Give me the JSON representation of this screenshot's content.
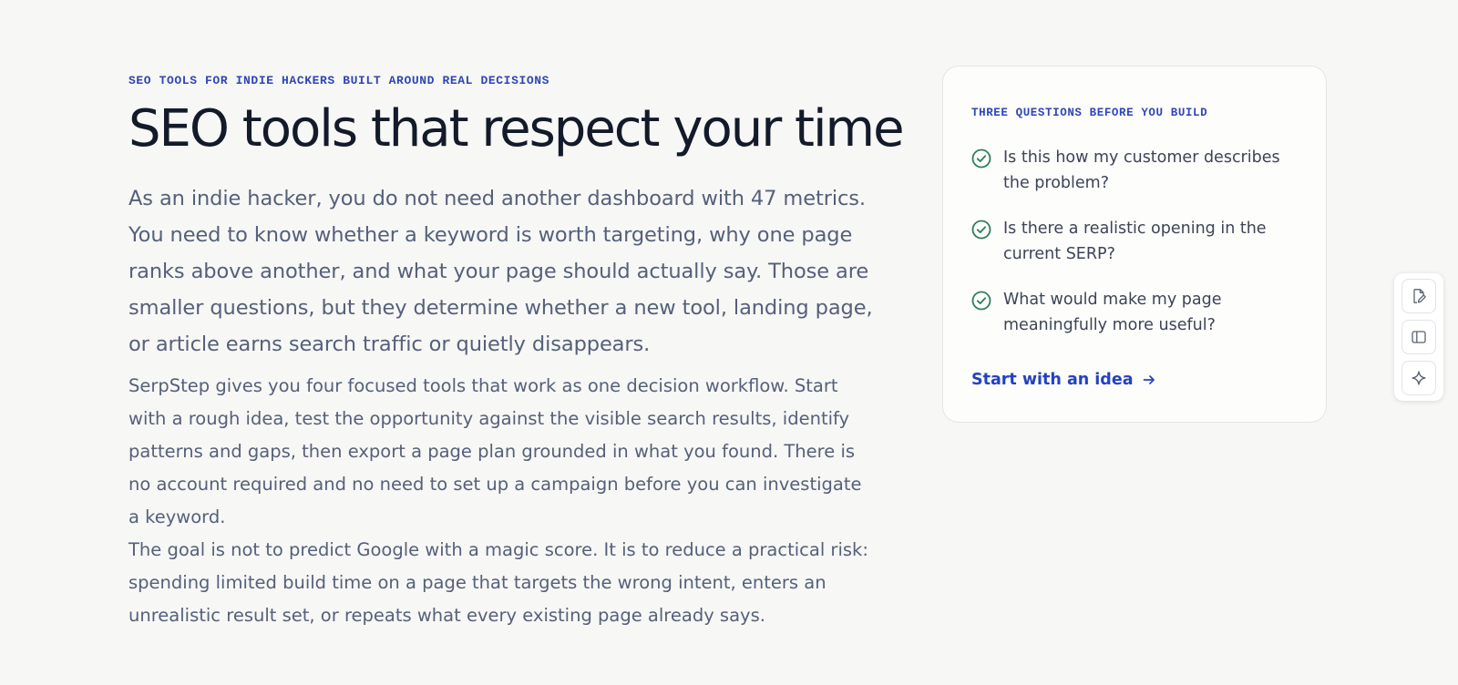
{
  "hero": {
    "eyebrow": "SEO TOOLS FOR INDIE HACKERS BUILT AROUND REAL DECISIONS",
    "title": "SEO tools that respect your time",
    "lead": "As an indie hacker, you do not need another dashboard with 47 metrics. You need to know whether a keyword is worth targeting, why one page ranks above another, and what your page should actually say. Those are smaller questions, but they determine whether a new tool, landing page, or article earns search traffic or quietly disappears.",
    "paragraphs": [
      "SerpStep gives you four focused tools that work as one decision workflow. Start with a rough idea, test the opportunity against the visible search results, identify patterns and gaps, then export a page plan grounded in what you found. There is no account required and no need to set up a campaign before you can investigate a keyword.",
      "The goal is not to predict Google with a magic score. It is to reduce a practical risk: spending limited build time on a page that targets the wrong intent, enters an unrealistic result set, or repeats what every existing page already says."
    ]
  },
  "card": {
    "eyebrow": "THREE QUESTIONS BEFORE YOU BUILD",
    "questions": [
      "Is this how my customer describes the problem?",
      "Is there a realistic opening in the current SERP?",
      "What would make my page meaningfully more useful?"
    ],
    "cta_label": "Start with an idea",
    "cta_icon": "arrow-right-icon",
    "check_icon": "check-circle-icon"
  },
  "toolbar": {
    "items": [
      {
        "icon": "edit-page-icon",
        "name": "edit-page-button"
      },
      {
        "icon": "sidebar-panel-icon",
        "name": "sidebar-toggle-button"
      },
      {
        "icon": "sparkle-icon",
        "name": "ai-assist-button"
      }
    ]
  },
  "colors": {
    "background": "#f7f7f5",
    "accent": "#2f46b8",
    "link": "#2342c2",
    "check": "#2f7d5b",
    "heading": "#131a2a",
    "body_text": "#55607a"
  }
}
